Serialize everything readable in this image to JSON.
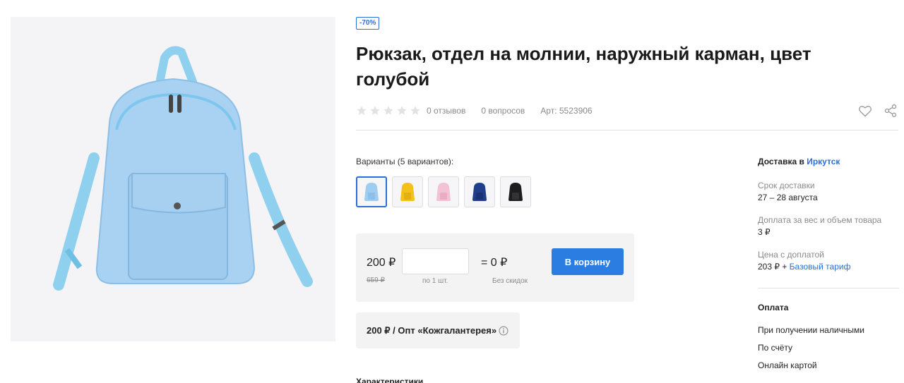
{
  "badge": {
    "discount": "-70%"
  },
  "product": {
    "title": "Рюкзак, отдел на молнии, наружный карман, цвет голубой",
    "image_icon": "backpack-photo"
  },
  "meta": {
    "rating": 0,
    "rating_max": 5,
    "reviews": "0 отзывов",
    "questions": "0 вопросов",
    "article": "Арт: 5523906",
    "favorite_icon": "heart-icon",
    "share_icon": "share-icon"
  },
  "variants": {
    "label": "Варианты (5 вариантов):",
    "items": [
      {
        "color_name": "голубой",
        "color": "#9fcdf0",
        "selected": true
      },
      {
        "color_name": "жёлтый",
        "color": "#f2c21b",
        "selected": false
      },
      {
        "color_name": "розовый",
        "color": "#f3c2d3",
        "selected": false
      },
      {
        "color_name": "синий",
        "color": "#1f3f8a",
        "selected": false
      },
      {
        "color_name": "чёрный",
        "color": "#1d1d1f",
        "selected": false
      }
    ]
  },
  "pricing": {
    "price": "200 ₽",
    "old_price": "659 ₽",
    "quantity_value": "",
    "per_unit": "по 1 шт.",
    "total": "= 0 ₽",
    "no_discount": "Без скидок",
    "cart_button": "В корзину"
  },
  "wholesale": {
    "text": "200 ₽ / Опт «Кожгалантерея»"
  },
  "characteristics": {
    "heading": "Характеристики"
  },
  "delivery": {
    "heading_prefix": "Доставка в ",
    "city": "Иркутск",
    "term_label": "Срок доставки",
    "term_value": "27 – 28 августа",
    "surcharge_label": "Доплата за вес и объем товара",
    "surcharge_value": "3 ₽",
    "price_with_surcharge_label": "Цена с доплатой",
    "price_with_surcharge_value": "203 ₽ + ",
    "tariff": "Базовый тариф"
  },
  "payment": {
    "heading": "Оплата",
    "options": [
      "При получении наличными",
      "По счёту",
      "Онлайн картой"
    ]
  },
  "colors": {
    "accent": "#2b6fd6",
    "button": "#2b7de1",
    "muted": "#8a8a8a",
    "panel": "#f3f3f4"
  }
}
